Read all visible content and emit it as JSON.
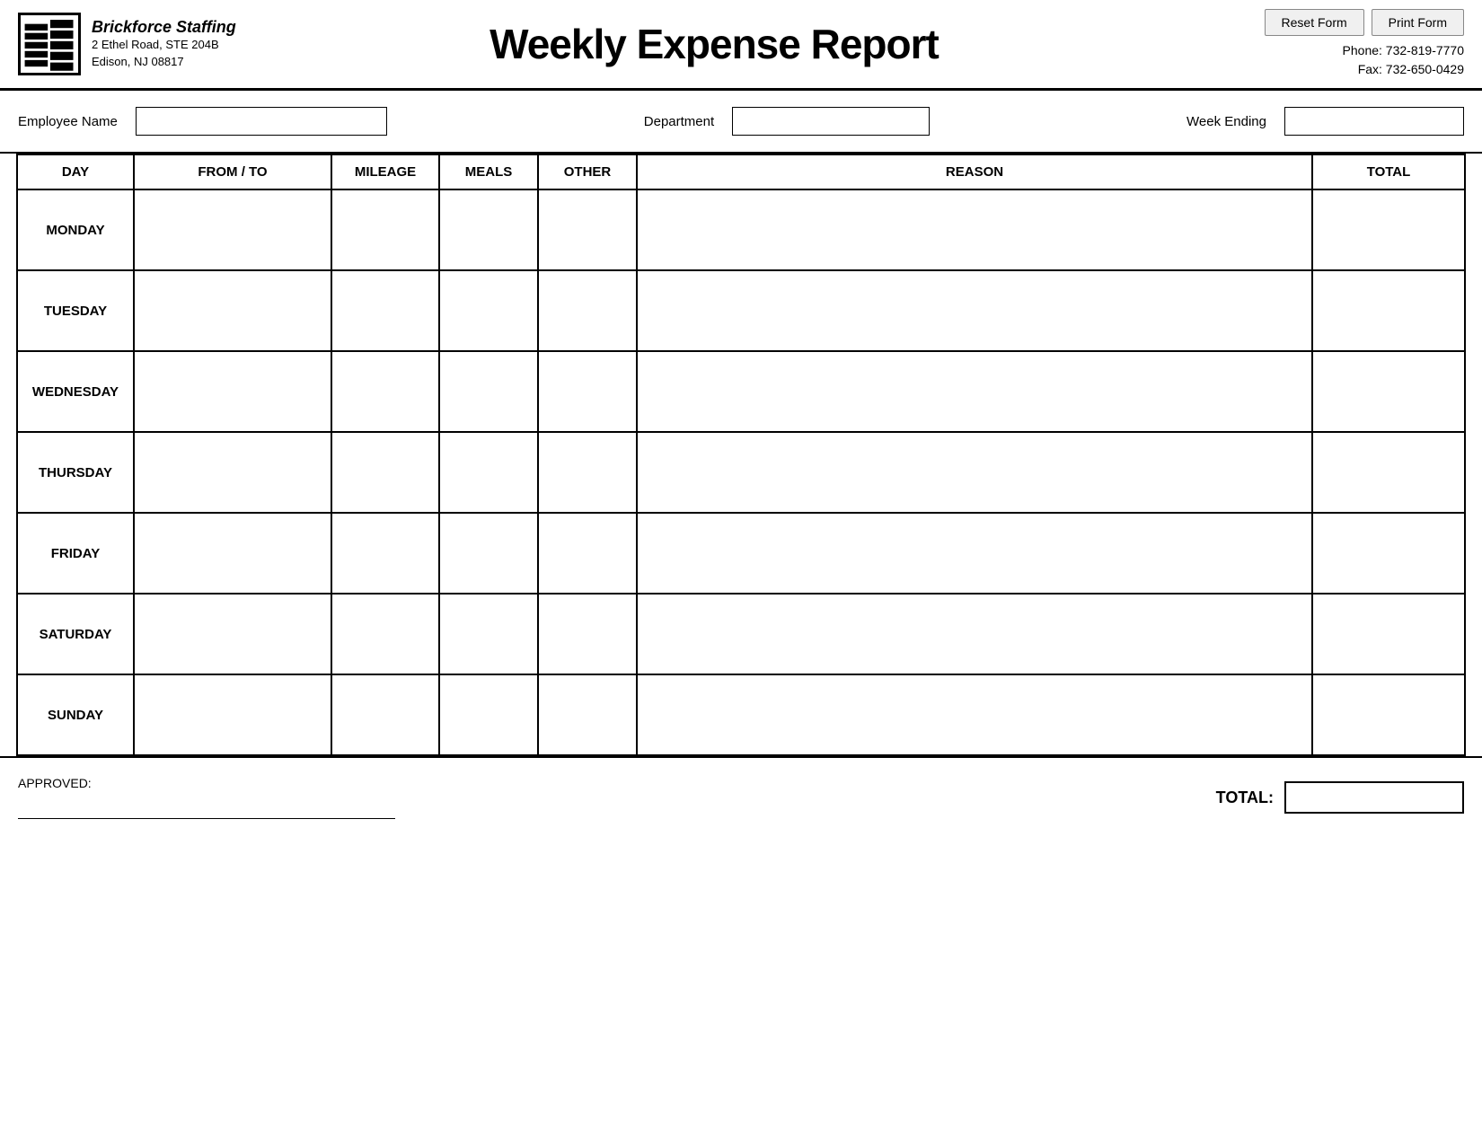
{
  "header": {
    "company_name": "Brickforce Staffing",
    "company_address_line1": "2 Ethel Road, STE 204B",
    "company_address_line2": "Edison, NJ 08817",
    "report_title": "Weekly Expense Report",
    "phone": "Phone: 732-819-7770",
    "fax": "Fax: 732-650-0429",
    "reset_button": "Reset Form",
    "print_button": "Print Form"
  },
  "employee_info": {
    "employee_name_label": "Employee Name",
    "department_label": "Department",
    "week_ending_label": "Week Ending",
    "employee_name_value": "",
    "department_value": "",
    "week_ending_value": ""
  },
  "table": {
    "columns": {
      "day": "DAY",
      "from_to": "FROM / TO",
      "mileage": "MILEAGE",
      "meals": "MEALS",
      "other": "OTHER",
      "reason": "REASON",
      "total": "TOTAL"
    },
    "rows": [
      {
        "day": "MONDAY"
      },
      {
        "day": "TUESDAY"
      },
      {
        "day": "WEDNESDAY"
      },
      {
        "day": "THURSDAY"
      },
      {
        "day": "FRIDAY"
      },
      {
        "day": "SATURDAY"
      },
      {
        "day": "SUNDAY"
      }
    ]
  },
  "footer": {
    "approved_label": "APPROVED:",
    "total_label": "TOTAL:"
  }
}
